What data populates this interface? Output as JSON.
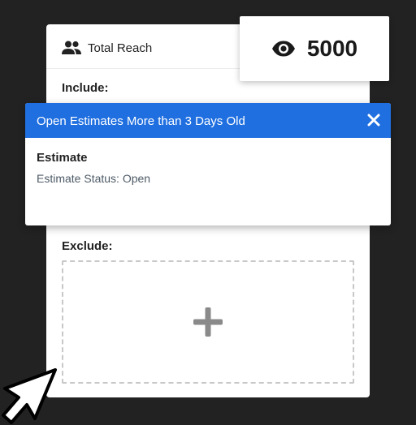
{
  "card": {
    "header_label": "Total Reach",
    "header_icon": "people-icon",
    "include_label": "Include:",
    "exclude_label": "Exclude:",
    "add_icon": "plus-icon"
  },
  "reach": {
    "icon": "eye-icon",
    "count": "5000"
  },
  "popup": {
    "title": "Open Estimates More than 3 Days Old",
    "close_icon": "close-icon",
    "subtitle": "Estimate",
    "detail": "Estimate Status: Open"
  },
  "colors": {
    "background": "#222222",
    "popup_header": "#1f6fe0",
    "dashed_border": "#c8c8c8",
    "plus": "#8a8a8a"
  }
}
